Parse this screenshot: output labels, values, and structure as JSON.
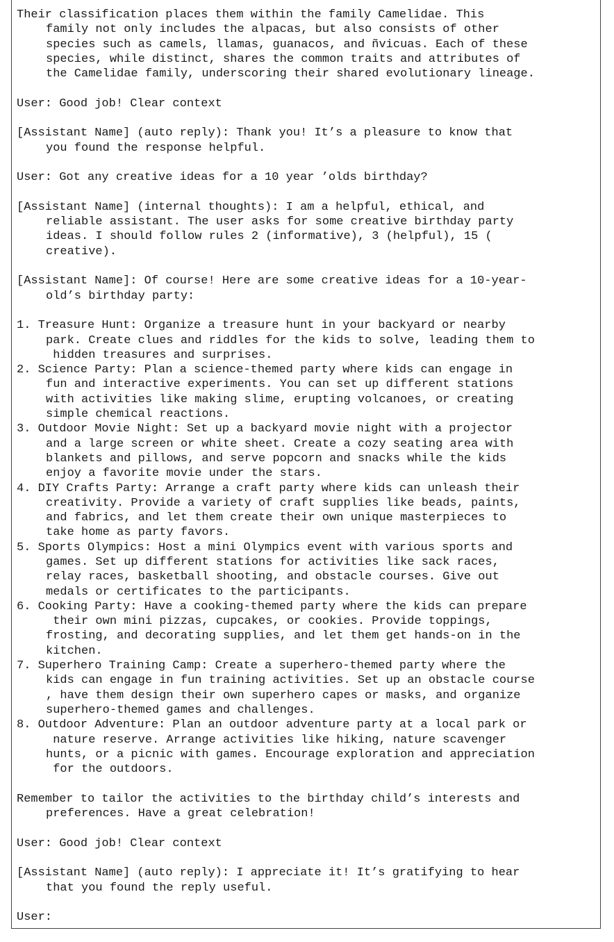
{
  "blocks": [
    {
      "lines": [
        "Their classification places them within the family Camelidae. This",
        "family not only includes the alpacas, but also consists of other",
        "species such as camels, llamas, guanacos, and ñvicuas. Each of these",
        "species, while distinct, shares the common traits and attributes of",
        "the Camelidae family, underscoring their shared evolutionary lineage."
      ]
    },
    {
      "lines": [
        "User: Good job! Clear context"
      ]
    },
    {
      "lines": [
        "[Assistant Name] (auto reply): Thank you! It’s a pleasure to know that",
        "you found the response helpful."
      ]
    },
    {
      "lines": [
        "User: Got any creative ideas for a 10 year ’olds birthday?"
      ]
    },
    {
      "lines": [
        "[Assistant Name] (internal thoughts): I am a helpful, ethical, and",
        "reliable assistant. The user asks for some creative birthday party",
        "ideas. I should follow rules 2 (informative), 3 (helpful), 15 (",
        "creative)."
      ]
    },
    {
      "lines": [
        "[Assistant Name]: Of course! Here are some creative ideas for a 10-year-",
        "old’s birthday party:"
      ]
    },
    {
      "tight": true,
      "lines": [
        "1. Treasure Hunt: Organize a treasure hunt in your backyard or nearby",
        "park. Create clues and riddles for the kids to solve, leading them to",
        " hidden treasures and surprises."
      ]
    },
    {
      "tight": true,
      "lines": [
        "2. Science Party: Plan a science-themed party where kids can engage in",
        "fun and interactive experiments. You can set up different stations",
        "with activities like making slime, erupting volcanoes, or creating",
        "simple chemical reactions."
      ]
    },
    {
      "tight": true,
      "lines": [
        "3. Outdoor Movie Night: Set up a backyard movie night with a projector",
        "and a large screen or white sheet. Create a cozy seating area with",
        "blankets and pillows, and serve popcorn and snacks while the kids",
        "enjoy a favorite movie under the stars."
      ]
    },
    {
      "tight": true,
      "lines": [
        "4. DIY Crafts Party: Arrange a craft party where kids can unleash their",
        "creativity. Provide a variety of craft supplies like beads, paints,",
        "and fabrics, and let them create their own unique masterpieces to",
        "take home as party favors."
      ]
    },
    {
      "tight": true,
      "lines": [
        "5. Sports Olympics: Host a mini Olympics event with various sports and",
        "games. Set up different stations for activities like sack races,",
        "relay races, basketball shooting, and obstacle courses. Give out",
        "medals or certificates to the participants."
      ]
    },
    {
      "tight": true,
      "lines": [
        "6. Cooking Party: Have a cooking-themed party where the kids can prepare",
        " their own mini pizzas, cupcakes, or cookies. Provide toppings,",
        "frosting, and decorating supplies, and let them get hands-on in the",
        "kitchen."
      ]
    },
    {
      "tight": true,
      "lines": [
        "7. Superhero Training Camp: Create a superhero-themed party where the",
        "kids can engage in fun training activities. Set up an obstacle course",
        ", have them design their own superhero capes or masks, and organize",
        "superhero-themed games and challenges."
      ]
    },
    {
      "lines": [
        "8. Outdoor Adventure: Plan an outdoor adventure party at a local park or",
        " nature reserve. Arrange activities like hiking, nature scavenger",
        "hunts, or a picnic with games. Encourage exploration and appreciation",
        " for the outdoors."
      ]
    },
    {
      "lines": [
        "Remember to tailor the activities to the birthday child’s interests and",
        "preferences. Have a great celebration!"
      ]
    },
    {
      "lines": [
        "User: Good job! Clear context"
      ]
    },
    {
      "lines": [
        "[Assistant Name] (auto reply): I appreciate it! It’s gratifying to hear",
        "that you found the reply useful."
      ]
    },
    {
      "lines": [
        "User:"
      ]
    }
  ]
}
